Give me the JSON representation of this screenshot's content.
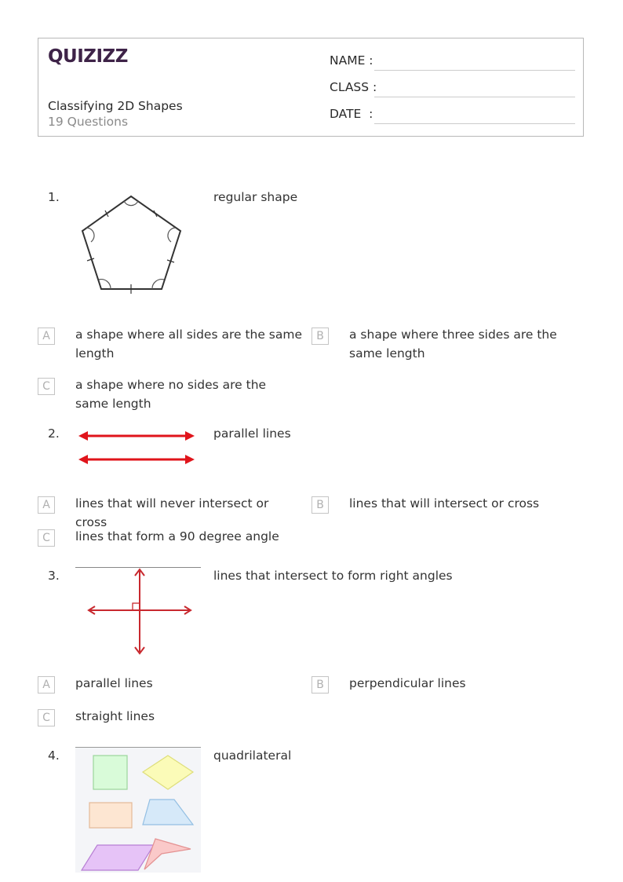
{
  "header": {
    "logo": "QUIZIZZ",
    "title": "Classifying 2D Shapes",
    "question_count": "19 Questions",
    "fields": [
      {
        "label": "NAME :"
      },
      {
        "label": "CLASS :"
      },
      {
        "label": "DATE  :"
      }
    ]
  },
  "colors": {
    "brand": "#3e2348",
    "arrow_red": "#e0141b",
    "perp_red": "#c8282e"
  },
  "questions": [
    {
      "number": "1.",
      "prompt": "regular shape",
      "image": "regular-pentagon-icon",
      "options": [
        {
          "letter": "A",
          "text": "a shape where all sides are the same length"
        },
        {
          "letter": "B",
          "text": "a shape where three sides are the same length"
        },
        {
          "letter": "C",
          "text": "a shape where no sides are the same length"
        }
      ]
    },
    {
      "number": "2.",
      "prompt": "parallel lines",
      "image": "parallel-arrows-icon",
      "options": [
        {
          "letter": "A",
          "text": "lines that will never intersect or cross"
        },
        {
          "letter": "B",
          "text": "lines that will intersect or cross"
        },
        {
          "letter": "C",
          "text": "lines that form a 90 degree angle"
        }
      ]
    },
    {
      "number": "3.",
      "prompt": "lines that intersect to form right angles",
      "image": "perpendicular-arrows-icon",
      "options": [
        {
          "letter": "A",
          "text": "parallel lines"
        },
        {
          "letter": "B",
          "text": "perpendicular lines"
        },
        {
          "letter": "C",
          "text": "straight lines"
        }
      ]
    },
    {
      "number": "4.",
      "prompt": "quadrilateral",
      "image": "quadrilaterals-icon"
    }
  ]
}
